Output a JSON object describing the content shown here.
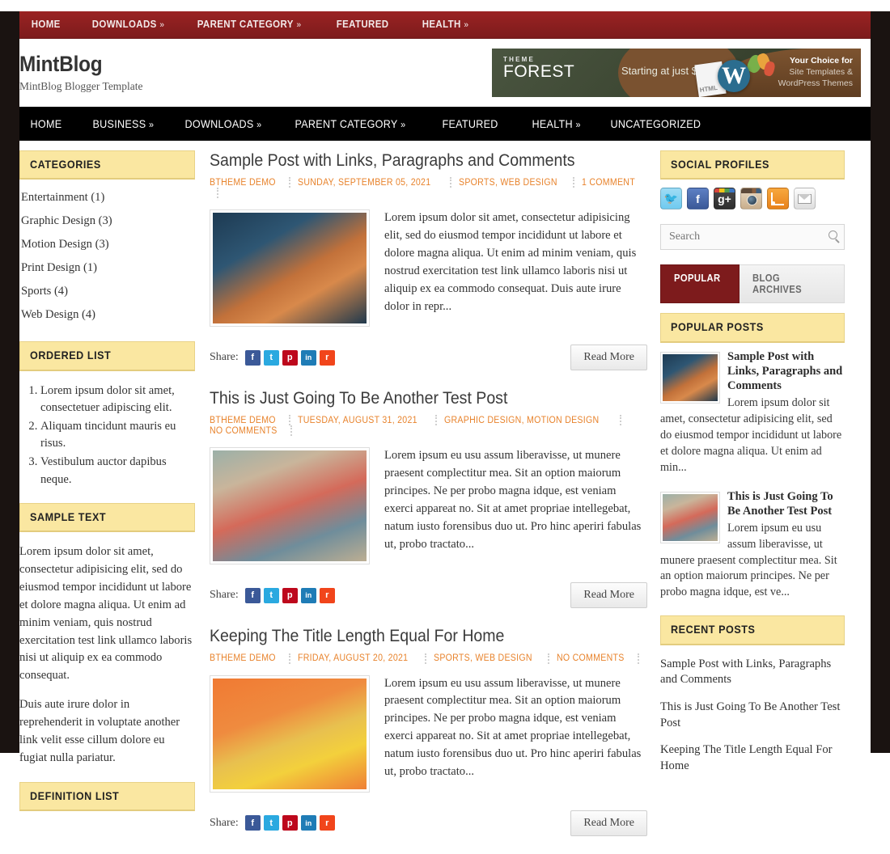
{
  "topnav": {
    "items": [
      {
        "label": "HOME",
        "caret": ""
      },
      {
        "label": "DOWNLOADS",
        "caret": "»"
      },
      {
        "label": "PARENT CATEGORY",
        "caret": "»"
      },
      {
        "label": "FEATURED",
        "caret": ""
      },
      {
        "label": "HEALTH",
        "caret": "»"
      }
    ]
  },
  "header": {
    "title": "MintBlog",
    "tagline": "MintBlog Blogger Template",
    "ad": {
      "logo_top": "THEME",
      "logo_main": "FOREST",
      "price": "Starting at just $10",
      "arrow": "►",
      "right_line1": "Your Choice for",
      "right_line2": "Site Templates &",
      "right_line3": "WordPress Themes",
      "doc_label": "HTML"
    }
  },
  "mainnav": {
    "items": [
      {
        "label": "HOME",
        "caret": ""
      },
      {
        "label": "BUSINESS",
        "caret": "»"
      },
      {
        "label": "DOWNLOADS",
        "caret": "»"
      },
      {
        "label": "PARENT CATEGORY",
        "caret": "»"
      },
      {
        "label": "FEATURED",
        "caret": ""
      },
      {
        "label": "HEALTH",
        "caret": "»"
      },
      {
        "label": "UNCATEGORIZED",
        "caret": ""
      }
    ]
  },
  "sidebar_left": {
    "categories": {
      "title": "CATEGORIES",
      "items": [
        "Entertainment (1)",
        "Graphic Design (3)",
        "Motion Design (3)",
        "Print Design (1)",
        "Sports (4)",
        "Web Design (4)"
      ]
    },
    "ordered_list": {
      "title": "ORDERED LIST",
      "items": [
        "Lorem ipsum dolor sit amet, consectetuer adipiscing elit.",
        "Aliquam tincidunt mauris eu risus.",
        "Vestibulum auctor dapibus neque."
      ]
    },
    "sample_text": {
      "title": "SAMPLE TEXT",
      "paragraphs": [
        "Lorem ipsum dolor sit amet, consectetur adipisicing elit, sed do eiusmod tempor incididunt ut labore et dolore magna aliqua. Ut enim ad minim veniam, quis nostrud exercitation test link ullamco laboris nisi ut aliquip ex ea commodo consequat.",
        "Duis aute irure dolor in reprehenderit in voluptate another link velit esse cillum dolore eu fugiat nulla pariatur."
      ]
    },
    "definition_list": {
      "title": "DEFINITION LIST"
    }
  },
  "posts": [
    {
      "title": "Sample Post with Links, Paragraphs and Comments",
      "author": "BTHEME DEMO",
      "date": "SUNDAY, SEPTEMBER 05, 2021",
      "categories": "SPORTS, WEB DESIGN",
      "comments": "1 COMMENT",
      "excerpt": "Lorem ipsum dolor sit amet, consectetur adipisicing elit, sed do eiusmod tempor incididunt ut labore et dolore magna aliqua. Ut enim ad minim veniam, quis nostrud exercitation test link ullamco laboris nisi ut aliquip ex ea commodo consequat. Duis aute irure dolor in repr...",
      "read_more": "Read More",
      "share_label": "Share:"
    },
    {
      "title": "This is Just Going To Be Another Test Post",
      "author": "BTHEME DEMO",
      "date": "TUESDAY, AUGUST 31, 2021",
      "categories": "GRAPHIC DESIGN, MOTION DESIGN",
      "comments": "NO COMMENTS",
      "excerpt": "Lorem ipsum eu usu assum liberavisse, ut munere praesent complectitur mea. Sit an option maiorum principes. Ne per probo magna idque, est veniam exerci appareat no. Sit at amet propriae intellegebat, natum iusto forensibus duo ut. Pro hinc aperiri fabulas ut, probo tractato...",
      "read_more": "Read More",
      "share_label": "Share:"
    },
    {
      "title": "Keeping The Title Length Equal For Home",
      "author": "BTHEME DEMO",
      "date": "FRIDAY, AUGUST 20, 2021",
      "categories": "SPORTS, WEB DESIGN",
      "comments": "NO COMMENTS",
      "excerpt": "Lorem ipsum eu usu assum liberavisse, ut munere praesent complectitur mea. Sit an option maiorum principes. Ne per probo magna idque, est veniam exerci appareat no. Sit at amet propriae intellegebat, natum iusto forensibus duo ut. Pro hinc aperiri fabulas ut, probo tractato...",
      "read_more": "Read More",
      "share_label": "Share:"
    }
  ],
  "share_buttons": [
    {
      "name": "facebook",
      "glyph": "f"
    },
    {
      "name": "twitter",
      "glyph": "t"
    },
    {
      "name": "pinterest",
      "glyph": "p"
    },
    {
      "name": "linkedin",
      "glyph": "in"
    },
    {
      "name": "reddit",
      "glyph": "r"
    }
  ],
  "sidebar_right": {
    "social": {
      "title": "SOCIAL PROFILES",
      "items": [
        "twitter",
        "facebook",
        "google-plus",
        "instagram",
        "rss",
        "email"
      ]
    },
    "search": {
      "placeholder": "Search",
      "value": ""
    },
    "tabs": [
      {
        "label": "POPULAR",
        "active": true
      },
      {
        "label": "BLOG ARCHIVES",
        "active": false
      }
    ],
    "popular": {
      "title": "POPULAR POSTS",
      "items": [
        {
          "title": "Sample Post with Links, Paragraphs and Comments",
          "excerpt": "Lorem ipsum dolor sit amet, consectetur adipisicing elit, sed do eiusmod tempor incididunt ut labore et dolore magna aliqua. Ut enim ad min..."
        },
        {
          "title": "This is Just Going To Be Another Test Post",
          "excerpt": "Lorem ipsum eu usu assum liberavisse, ut munere praesent complectitur mea. Sit an option maiorum principes. Ne per probo magna idque, est ve..."
        }
      ]
    },
    "recent": {
      "title": "RECENT POSTS",
      "items": [
        "Sample Post with Links, Paragraphs and Comments",
        "This is Just Going To Be Another Test Post",
        "Keeping The Title Length Equal For Home"
      ]
    }
  },
  "colors": {
    "maroon": "#7d1b1c",
    "orange": "#e8832c",
    "widget_header": "#fae7a1",
    "black_nav": "#000000"
  }
}
